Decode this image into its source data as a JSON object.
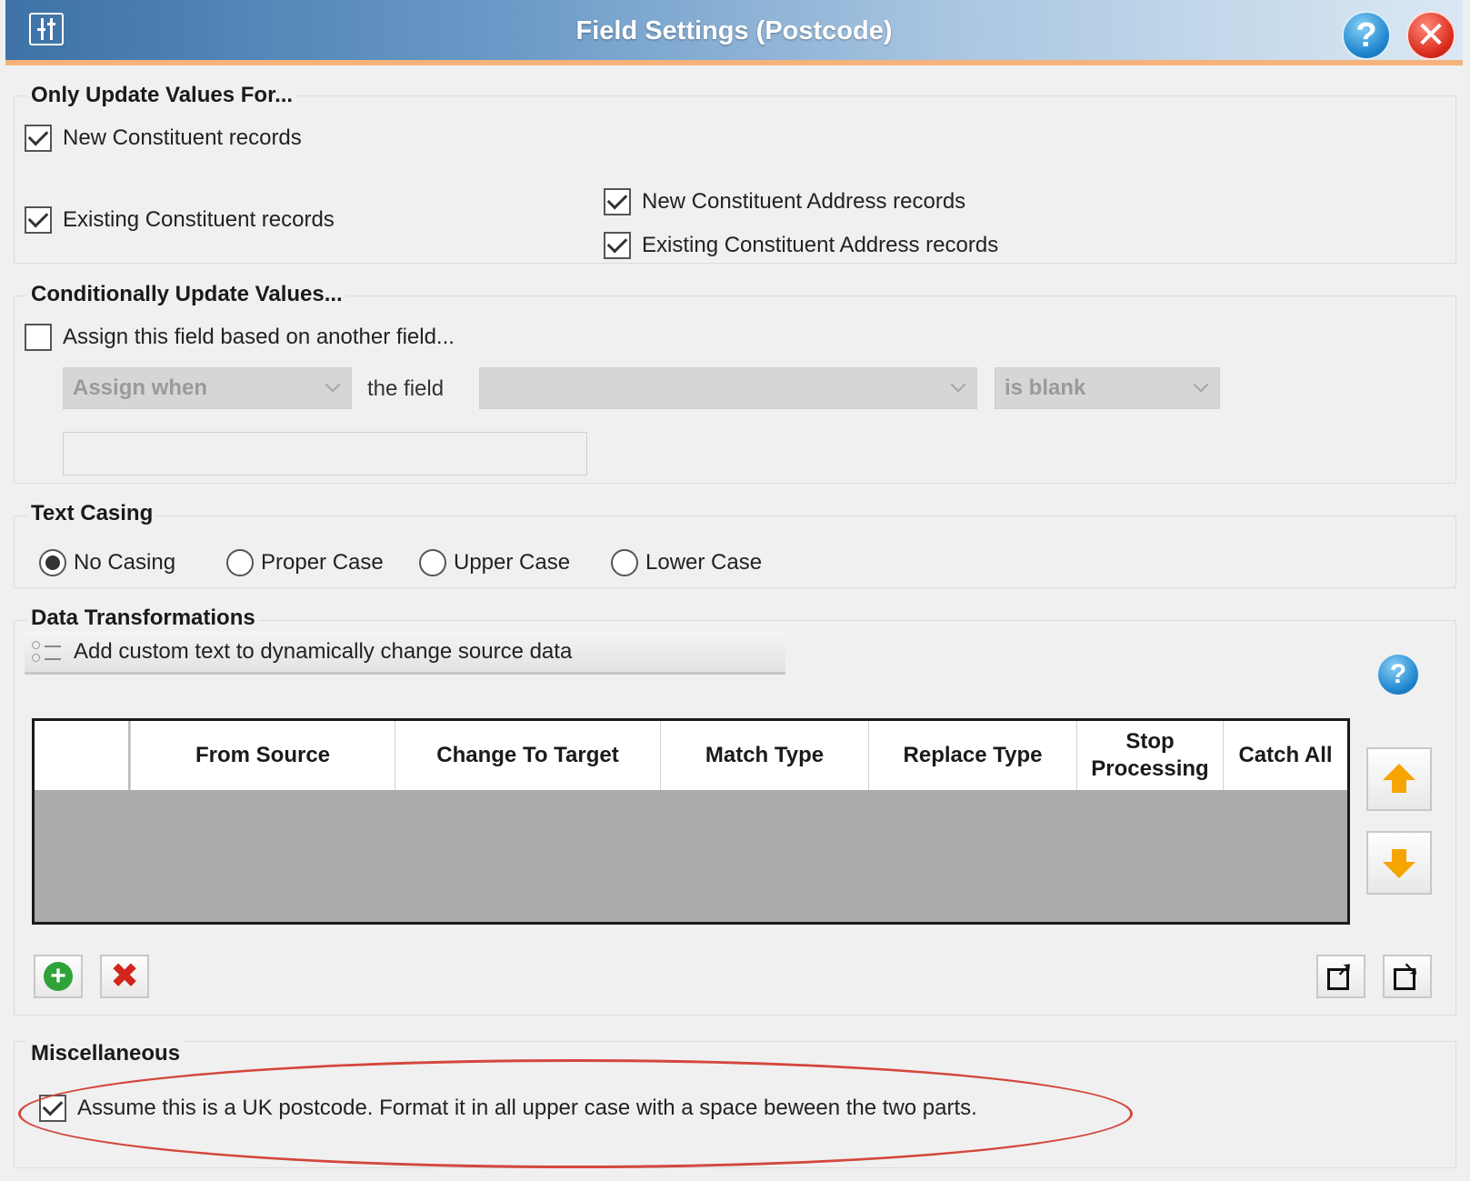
{
  "window": {
    "title": "Field Settings (Postcode)",
    "help_glyph": "?",
    "close_glyph": "✕"
  },
  "only_update": {
    "title": "Only Update Values For...",
    "new_constituent": {
      "label": "New Constituent records",
      "checked": true
    },
    "existing_constituent": {
      "label": "Existing Constituent records",
      "checked": true
    },
    "new_address": {
      "label": "New Constituent Address records",
      "checked": true
    },
    "existing_address": {
      "label": "Existing Constituent Address records",
      "checked": true
    }
  },
  "conditional": {
    "title": "Conditionally Update Values...",
    "assign_checkbox": {
      "label": "Assign this field based on another field...",
      "checked": false
    },
    "assign_when": "Assign when",
    "the_field_label": "the field",
    "field_value": "",
    "condition": "is blank",
    "value_input": ""
  },
  "text_casing": {
    "title": "Text Casing",
    "options": [
      "No Casing",
      "Proper Case",
      "Upper Case",
      "Lower Case"
    ],
    "selected": "No Casing"
  },
  "data_transformations": {
    "title": "Data Transformations",
    "custom_text_label": "Add custom text to dynamically change source data",
    "help_glyph": "?",
    "columns": [
      "",
      "From Source",
      "Change To Target",
      "Match Type",
      "Replace Type",
      "Stop\nProcessing",
      "Catch All"
    ],
    "rows": []
  },
  "miscellaneous": {
    "title": "Miscellaneous",
    "uk_postcode": {
      "label": "Assume this is a UK postcode. Format it in all upper case with a space beween the two parts.",
      "checked": true
    }
  },
  "colors": {
    "title_bar_start": "#3d72a6",
    "title_bar_end": "#dbe8f3",
    "title_accent": "#f5b27a",
    "highlight": "#d4463c",
    "arrow": "#f6a400"
  }
}
